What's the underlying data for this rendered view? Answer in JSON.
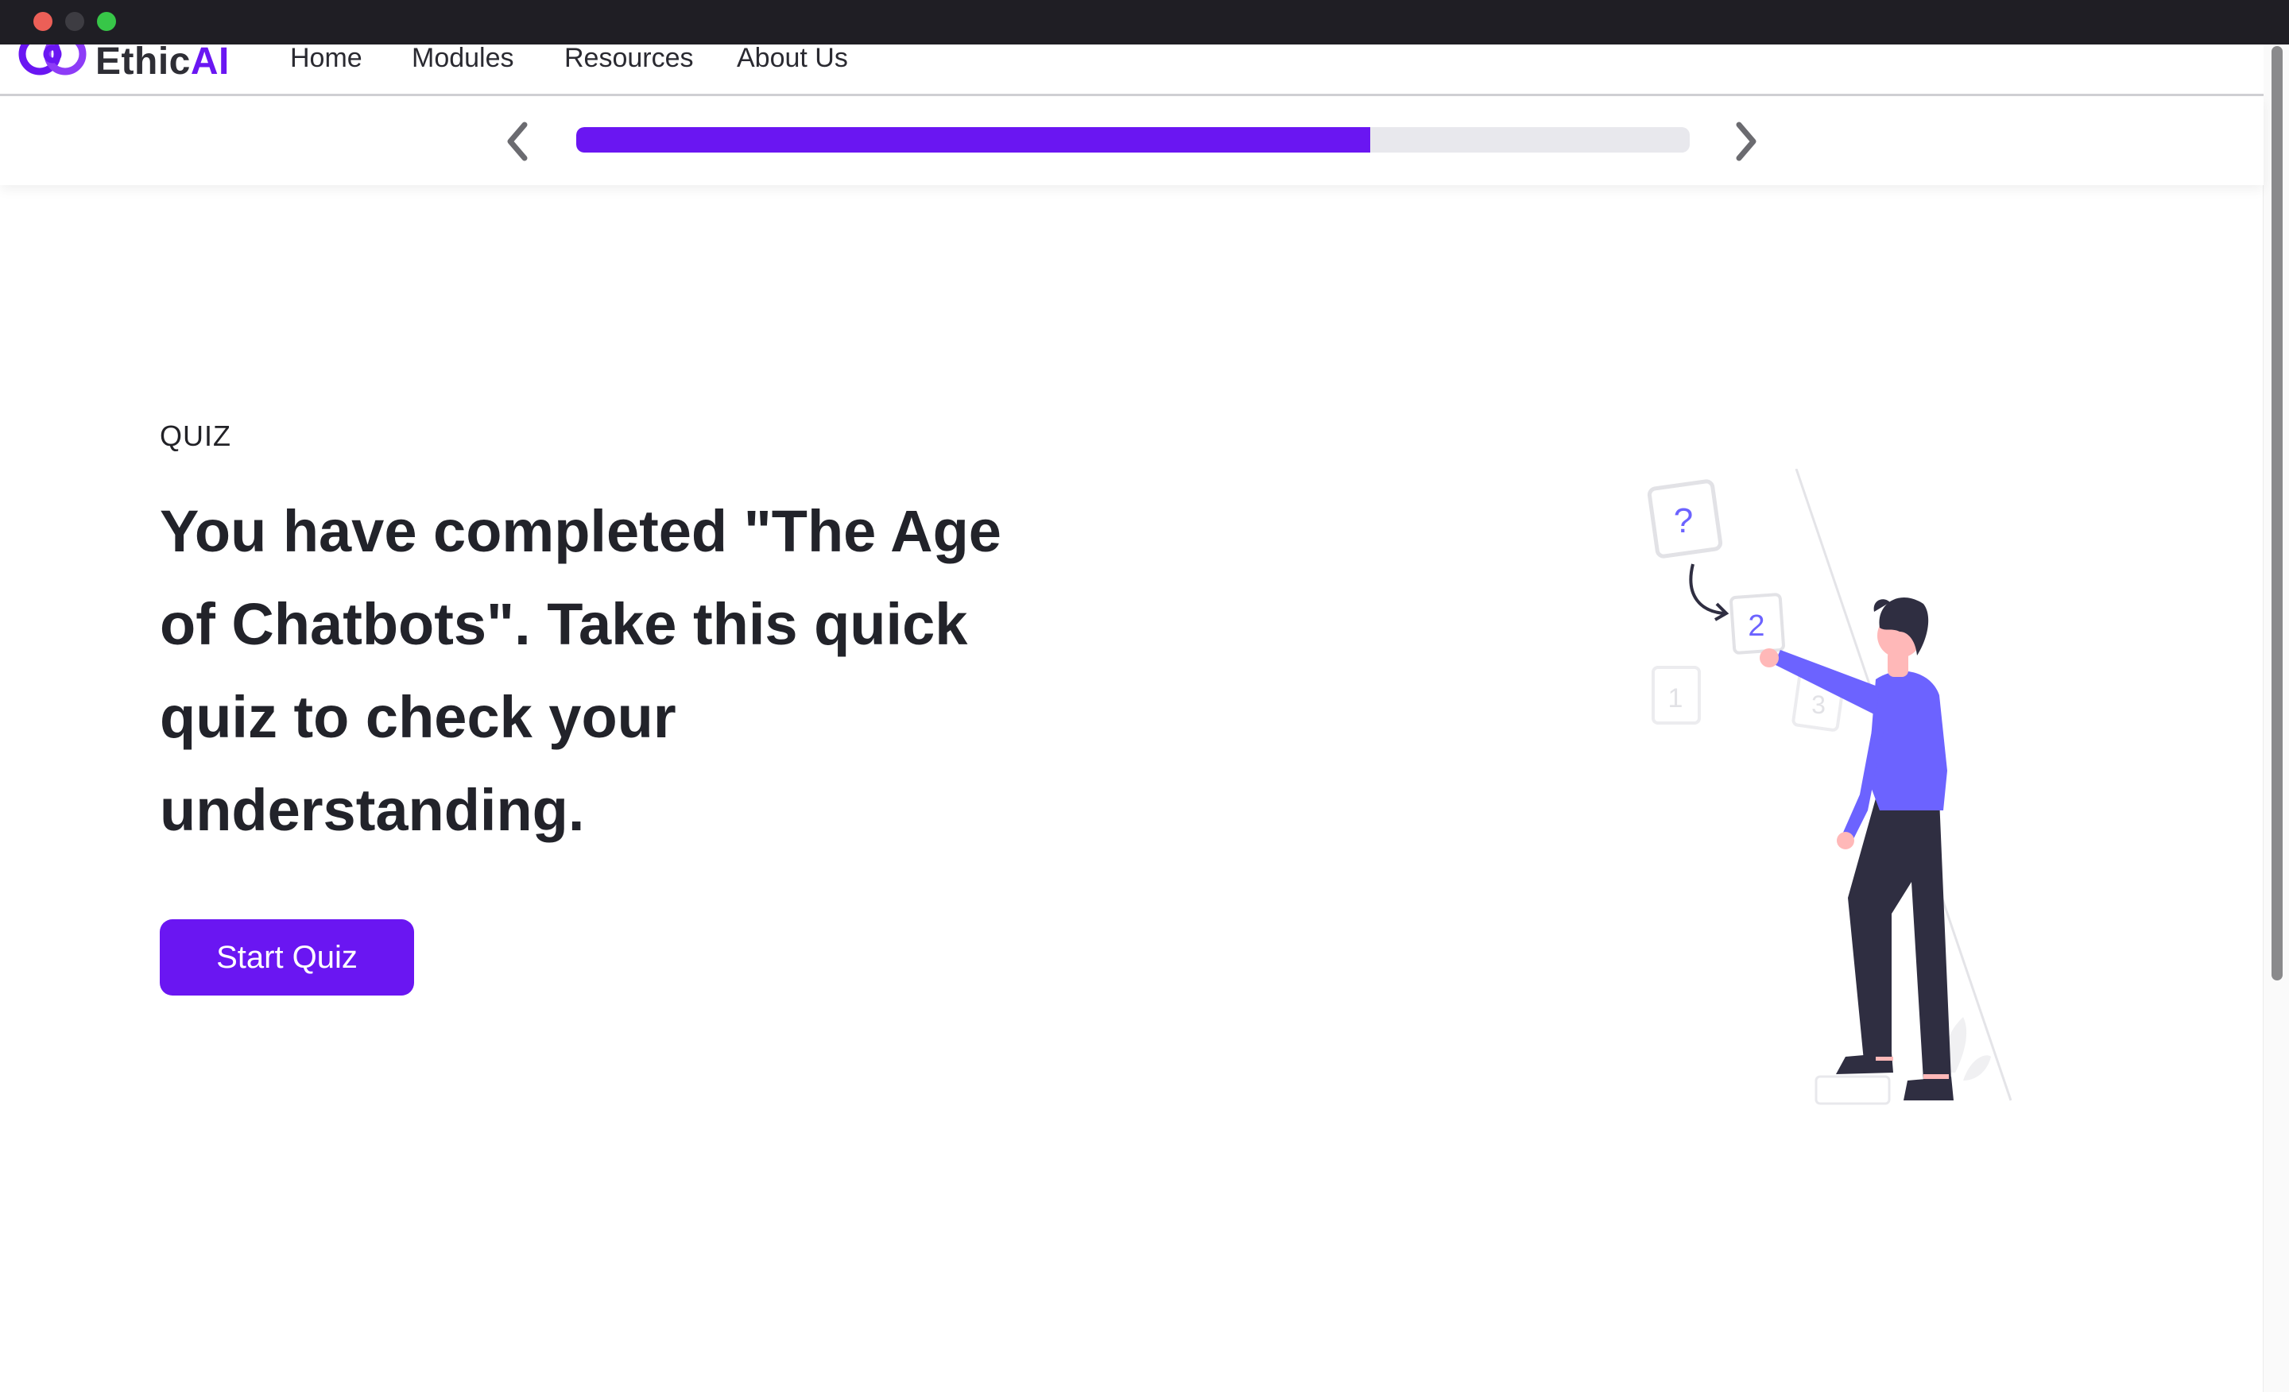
{
  "window": {
    "controls": [
      "close",
      "minimize",
      "maximize"
    ]
  },
  "navbar": {
    "logo": {
      "text_part1": "Ethic",
      "text_part2": "AI",
      "icon": "ethicai-logo-icon"
    },
    "links": [
      {
        "label": "Home"
      },
      {
        "label": "Modules"
      },
      {
        "label": "Resources"
      },
      {
        "label": "About Us"
      }
    ]
  },
  "progress": {
    "fraction": 0.713,
    "prev_icon": "chevron-left-icon",
    "next_icon": "chevron-right-icon"
  },
  "main": {
    "eyebrow": "QUIZ",
    "headline": "You have completed \"The Age of Chatbots\". Take this quick quiz to check your understanding.",
    "button_label": "Start Quiz",
    "illustration": "person-with-question-cards-illustration"
  },
  "colors": {
    "accent": "#6a16f2",
    "person_shirt": "#6c63ff",
    "text": "#22232a"
  }
}
